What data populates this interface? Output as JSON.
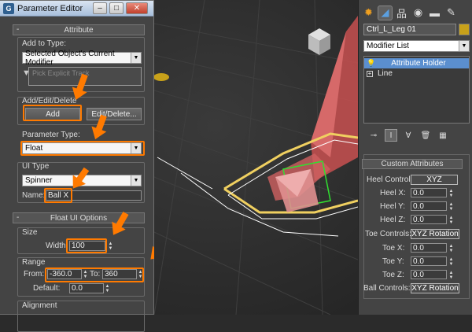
{
  "editor": {
    "title": "Parameter Editor",
    "attribute_rollout": "Attribute",
    "add_to_type_label": "Add to Type:",
    "add_to_type_value": "Selected Object's Current Modifier",
    "pick_track_label": "Pick Explicit Track",
    "add_edit_delete_label": "Add/Edit/Delete",
    "add_button": "Add",
    "edit_delete_button": "Edit/Delete...",
    "param_type_label": "Parameter Type:",
    "param_type_value": "Float",
    "ui_type_label": "UI Type",
    "ui_type_value": "Spinner",
    "name_label": "Name:",
    "name_value": "Ball X",
    "float_options_rollout": "Float UI Options",
    "size_label": "Size",
    "width_label": "Width:",
    "width_value": "100",
    "range_label": "Range",
    "from_label": "From:",
    "from_value": "-360.0",
    "to_label": "To:",
    "to_value": "360",
    "default_label": "Default:",
    "default_value": "0.0",
    "alignment_label": "Alignment"
  },
  "panel": {
    "object_name": "Ctrl_L_Leg 01",
    "modifier_list": "Modifier List",
    "stack": [
      {
        "label": "Attribute Holder"
      },
      {
        "label": "Line"
      }
    ],
    "ca_title": "Custom Attributes",
    "heel_control_label": "Heel Control:",
    "heel_control_btn": "XYZ",
    "heel_x_label": "Heel X:",
    "heel_x_value": "0.0",
    "heel_y_label": "Heel Y:",
    "heel_y_value": "0.0",
    "heel_z_label": "Heel Z:",
    "heel_z_value": "0.0",
    "toe_controls_label": "Toe Controls:",
    "toe_controls_btn": "XYZ Rotation",
    "toe_x_label": "Toe X:",
    "toe_x_value": "0.0",
    "toe_y_label": "Toe Y:",
    "toe_y_value": "0.0",
    "toe_z_label": "Toe Z:",
    "toe_z_value": "0.0",
    "ball_controls_label": "Ball Controls:",
    "ball_controls_btn": "XYZ Rotation"
  },
  "colors": {
    "highlight": "#ff7a00",
    "selection": "#5b8fcf",
    "object_color": "#c8a11a"
  }
}
